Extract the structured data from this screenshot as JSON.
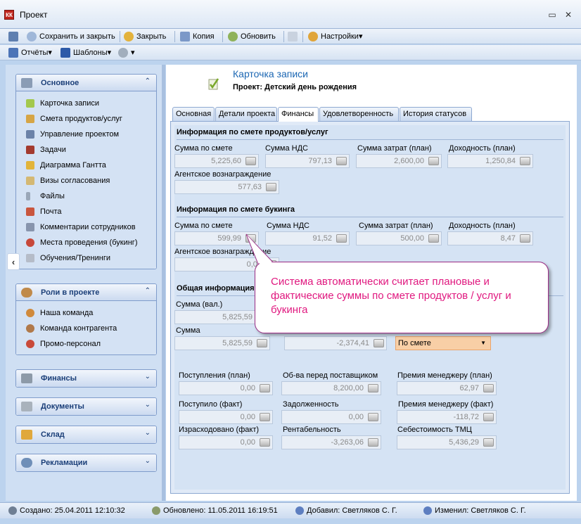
{
  "window": {
    "badge": "КК",
    "title": "Проект",
    "min_glyph": "▭",
    "close_glyph": "✕"
  },
  "toolbar1": {
    "save_close": "Сохранить и закрыть",
    "close": "Закрыть",
    "copy": "Копия",
    "refresh": "Обновить",
    "settings": "Настройки"
  },
  "toolbar2": {
    "reports": "Отчёты",
    "templates": "Шаблоны"
  },
  "sidebar": {
    "groups": [
      {
        "title": "Основное",
        "items": [
          "Карточка записи",
          "Смета продуктов/услуг",
          "Управление проектом",
          "Задачи",
          "Диаграмма Гантта",
          "Визы согласования",
          "Файлы",
          "Почта",
          "Комментарии сотрудников",
          "Места проведения (букинг)",
          "Обучения/Тренинги"
        ]
      },
      {
        "title": "Роли в проекте",
        "items": [
          "Наша команда",
          "Команда контрагента",
          "Промо-персонал"
        ]
      },
      {
        "title": "Финансы",
        "items": []
      },
      {
        "title": "Документы",
        "items": []
      },
      {
        "title": "Склад",
        "items": []
      },
      {
        "title": "Рекламации",
        "items": []
      }
    ]
  },
  "card": {
    "title": "Карточка записи",
    "project_label": "Проект:",
    "project_name": "Детский день рождения"
  },
  "tabs": [
    "Основная",
    "Детали проекта",
    "Финансы",
    "Удовлетворенность",
    "История статусов"
  ],
  "active_tab": "Финансы",
  "sections": {
    "products": {
      "title": "Информация по смете продуктов/услуг",
      "sum": {
        "label": "Сумма по смете",
        "value": "5,225,60"
      },
      "vat": {
        "label": "Сумма НДС",
        "value": "797,13"
      },
      "cost": {
        "label": "Сумма затрат (план)",
        "value": "2,600,00"
      },
      "profit": {
        "label": "Доходность (план)",
        "value": "1,250,84"
      },
      "agent": {
        "label": "Агентское вознаграждение",
        "value": "577,63"
      }
    },
    "booking": {
      "title": "Информация по смете букинга",
      "sum": {
        "label": "Сумма по смете",
        "value": "599,99"
      },
      "vat": {
        "label": "Сумма НДС",
        "value": "91,52"
      },
      "cost": {
        "label": "Сумма затрат (план)",
        "value": "500,00"
      },
      "profit": {
        "label": "Доходность (план)",
        "value": "8,47"
      },
      "agent": {
        "label": "Агентское вознаграждение",
        "value": "0,00"
      }
    },
    "general": {
      "title": "Общая информация",
      "sum_cur": {
        "label": "Сумма (вал.)",
        "value": "5,825,59"
      },
      "sum": {
        "label": "Сумма",
        "value": "5,825,59"
      },
      "hidden_value": "-2,374,41",
      "calc_mode": "По смете",
      "income_plan": {
        "label": "Поступления (план)",
        "value": "0,00"
      },
      "supplier_debt": {
        "label": "Об-ва перед поставщиком",
        "value": "8,200,00"
      },
      "bonus_plan": {
        "label": "Премия менеджеру (план)",
        "value": "62,97"
      },
      "income_fact": {
        "label": "Поступило (факт)",
        "value": "0,00"
      },
      "debt": {
        "label": "Задолженность",
        "value": "0,00"
      },
      "bonus_fact": {
        "label": "Премия менеджеру (факт)",
        "value": "-118,72"
      },
      "spent_fact": {
        "label": "Израсходовано (факт)",
        "value": "0,00"
      },
      "profitability": {
        "label": "Рентабельность",
        "value": "-3,263,06"
      },
      "tmc_cost": {
        "label": "Себестоимость ТМЦ",
        "value": "5,436,29"
      }
    }
  },
  "callout": {
    "text": "Система автоматически считает плановые и фактические суммы по смете продуктов / услуг и букинга"
  },
  "status": {
    "created": "Создано: 25.04.2011 12:10:32",
    "updated": "Обновлено: 11.05.2011 16:19:51",
    "added_by": "Добавил: Светляков С. Г.",
    "modified_by": "Изменил: Светляков С. Г."
  }
}
